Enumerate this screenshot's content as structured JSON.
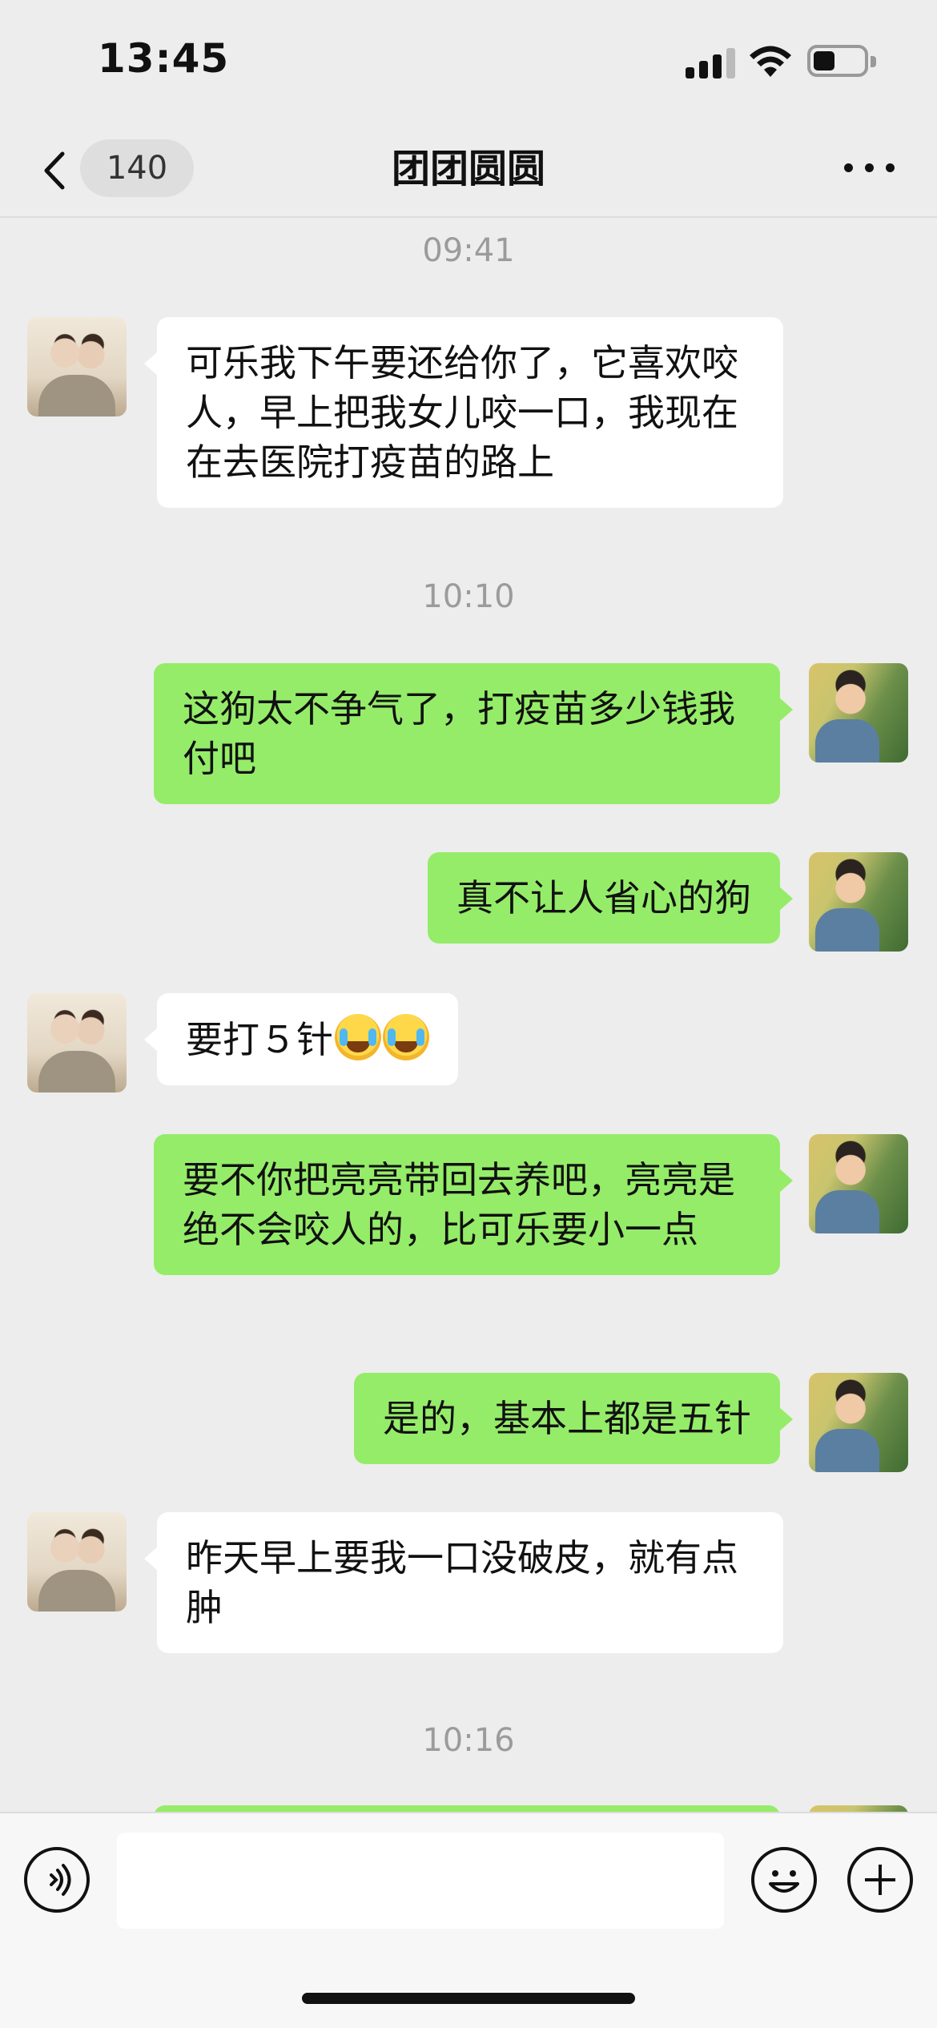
{
  "status_bar": {
    "time": "13:45",
    "icons": [
      "signal-icon",
      "wifi-icon",
      "battery-icon"
    ]
  },
  "nav": {
    "back_count": "140",
    "title": "团团圆圆",
    "icons": [
      "back-chevron-icon",
      "more-icon"
    ]
  },
  "messages": {
    "t1": "09:41",
    "m1": "可乐我下午要还给你了，它喜欢咬人，早上把我女儿咬一口，我现在在去医院打疫苗的路上",
    "t2": "10:10",
    "m2": "这狗太不争气了，打疫苗多少钱我付吧",
    "m3": "真不让人省心的狗",
    "m4": "要打５针",
    "m4_emoji": "loudly-crying-face-emoji x2",
    "m5": "要不你把亮亮带回去养吧，亮亮是绝不会咬人的，比可乐要小一点",
    "m6": "是的，基本上都是五针",
    "m7": "昨天早上要我一口没破皮，就有点肿",
    "t3": "10:16"
  },
  "input_bar": {
    "value": "",
    "icons": [
      "voice-icon",
      "emoji-icon",
      "plus-icon"
    ]
  },
  "colors": {
    "background": "#ededed",
    "self_bubble": "#95ec69",
    "other_bubble": "#ffffff",
    "timestamp": "#9b9b9b"
  }
}
